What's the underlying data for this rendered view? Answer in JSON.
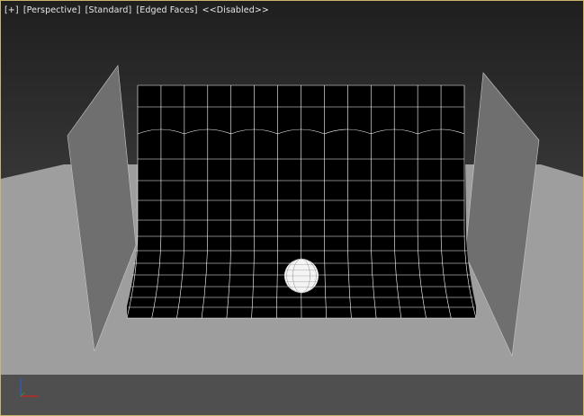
{
  "viewport": {
    "menu_plus": "[+]",
    "menu_view": "[Perspective]",
    "menu_shading": "[Standard]",
    "menu_edged": "[Edged Faces]",
    "menu_status": "<<Disabled>>"
  },
  "colors": {
    "background_top": "#1f1f1f",
    "background_bottom": "#3c3c3c",
    "ground": "#9e9e9e",
    "ground_front": "#5a5a5a",
    "side_panel": "#6e6e6e",
    "backdrop": "#000000",
    "wire": "#ffffff",
    "border": "#c9b46a",
    "axis_x": "#d02020",
    "axis_z": "#2a5ad0"
  },
  "icons": [
    "axis-tripod-icon"
  ]
}
